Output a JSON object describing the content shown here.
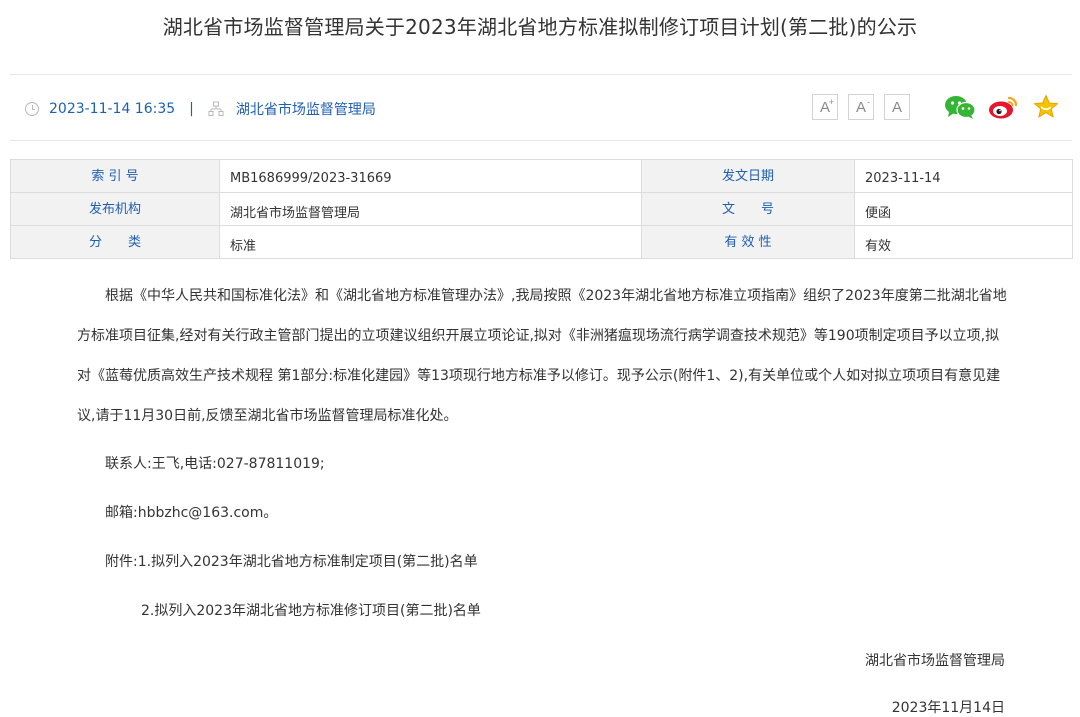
{
  "title": "湖北省市场监督管理局关于2023年湖北省地方标准拟制修订项目计划(第二批)的公示",
  "meta": {
    "datetime": "2023-11-14 16:35",
    "separator": "|",
    "publisher": "湖北省市场监督管理局"
  },
  "tools": {
    "font_large": "A",
    "font_large_sup": "+",
    "font_small": "A",
    "font_small_sup": "-",
    "font_default": "A"
  },
  "info_table": [
    {
      "k1": "索 引 号",
      "v1": "MB1686999/2023-31669",
      "k2": "发文日期",
      "v2": "2023-11-14"
    },
    {
      "k1": "发布机构",
      "v1": "湖北省市场监督管理局",
      "k2": "文　　号",
      "v2": "便函"
    },
    {
      "k1": "分　　类",
      "v1": "标准",
      "k2": "有 效 性",
      "v2": "有效"
    }
  ],
  "content": {
    "para1": "根据《中华人民共和国标准化法》和《湖北省地方标准管理办法》,我局按照《2023年湖北省地方标准立项指南》组织了2023年度第二批湖北省地方标准项目征集,经对有关行政主管部门提出的立项建议组织开展立项论证,拟对《非洲猪瘟现场流行病学调查技术规范》等190项制定项目予以立项,拟对《蓝莓优质高效生产技术规程 第1部分:标准化建园》等13项现行地方标准予以修订。现予公示(附件1、2),有关单位或个人如对拟立项项目有意见建议,请于11月30日前,反馈至湖北省市场监督管理局标准化处。",
    "contact": "联系人:王飞,电话:027-87811019;",
    "email": "邮箱:hbbzhc@163.com。",
    "attachment1": "附件:1.拟列入2023年湖北省地方标准制定项目(第二批)名单",
    "attachment2": "2.拟列入2023年湖北省地方标准修订项目(第二批)名单",
    "signature_org": "湖北省市场监督管理局",
    "signature_date": "2023年11月14日"
  }
}
